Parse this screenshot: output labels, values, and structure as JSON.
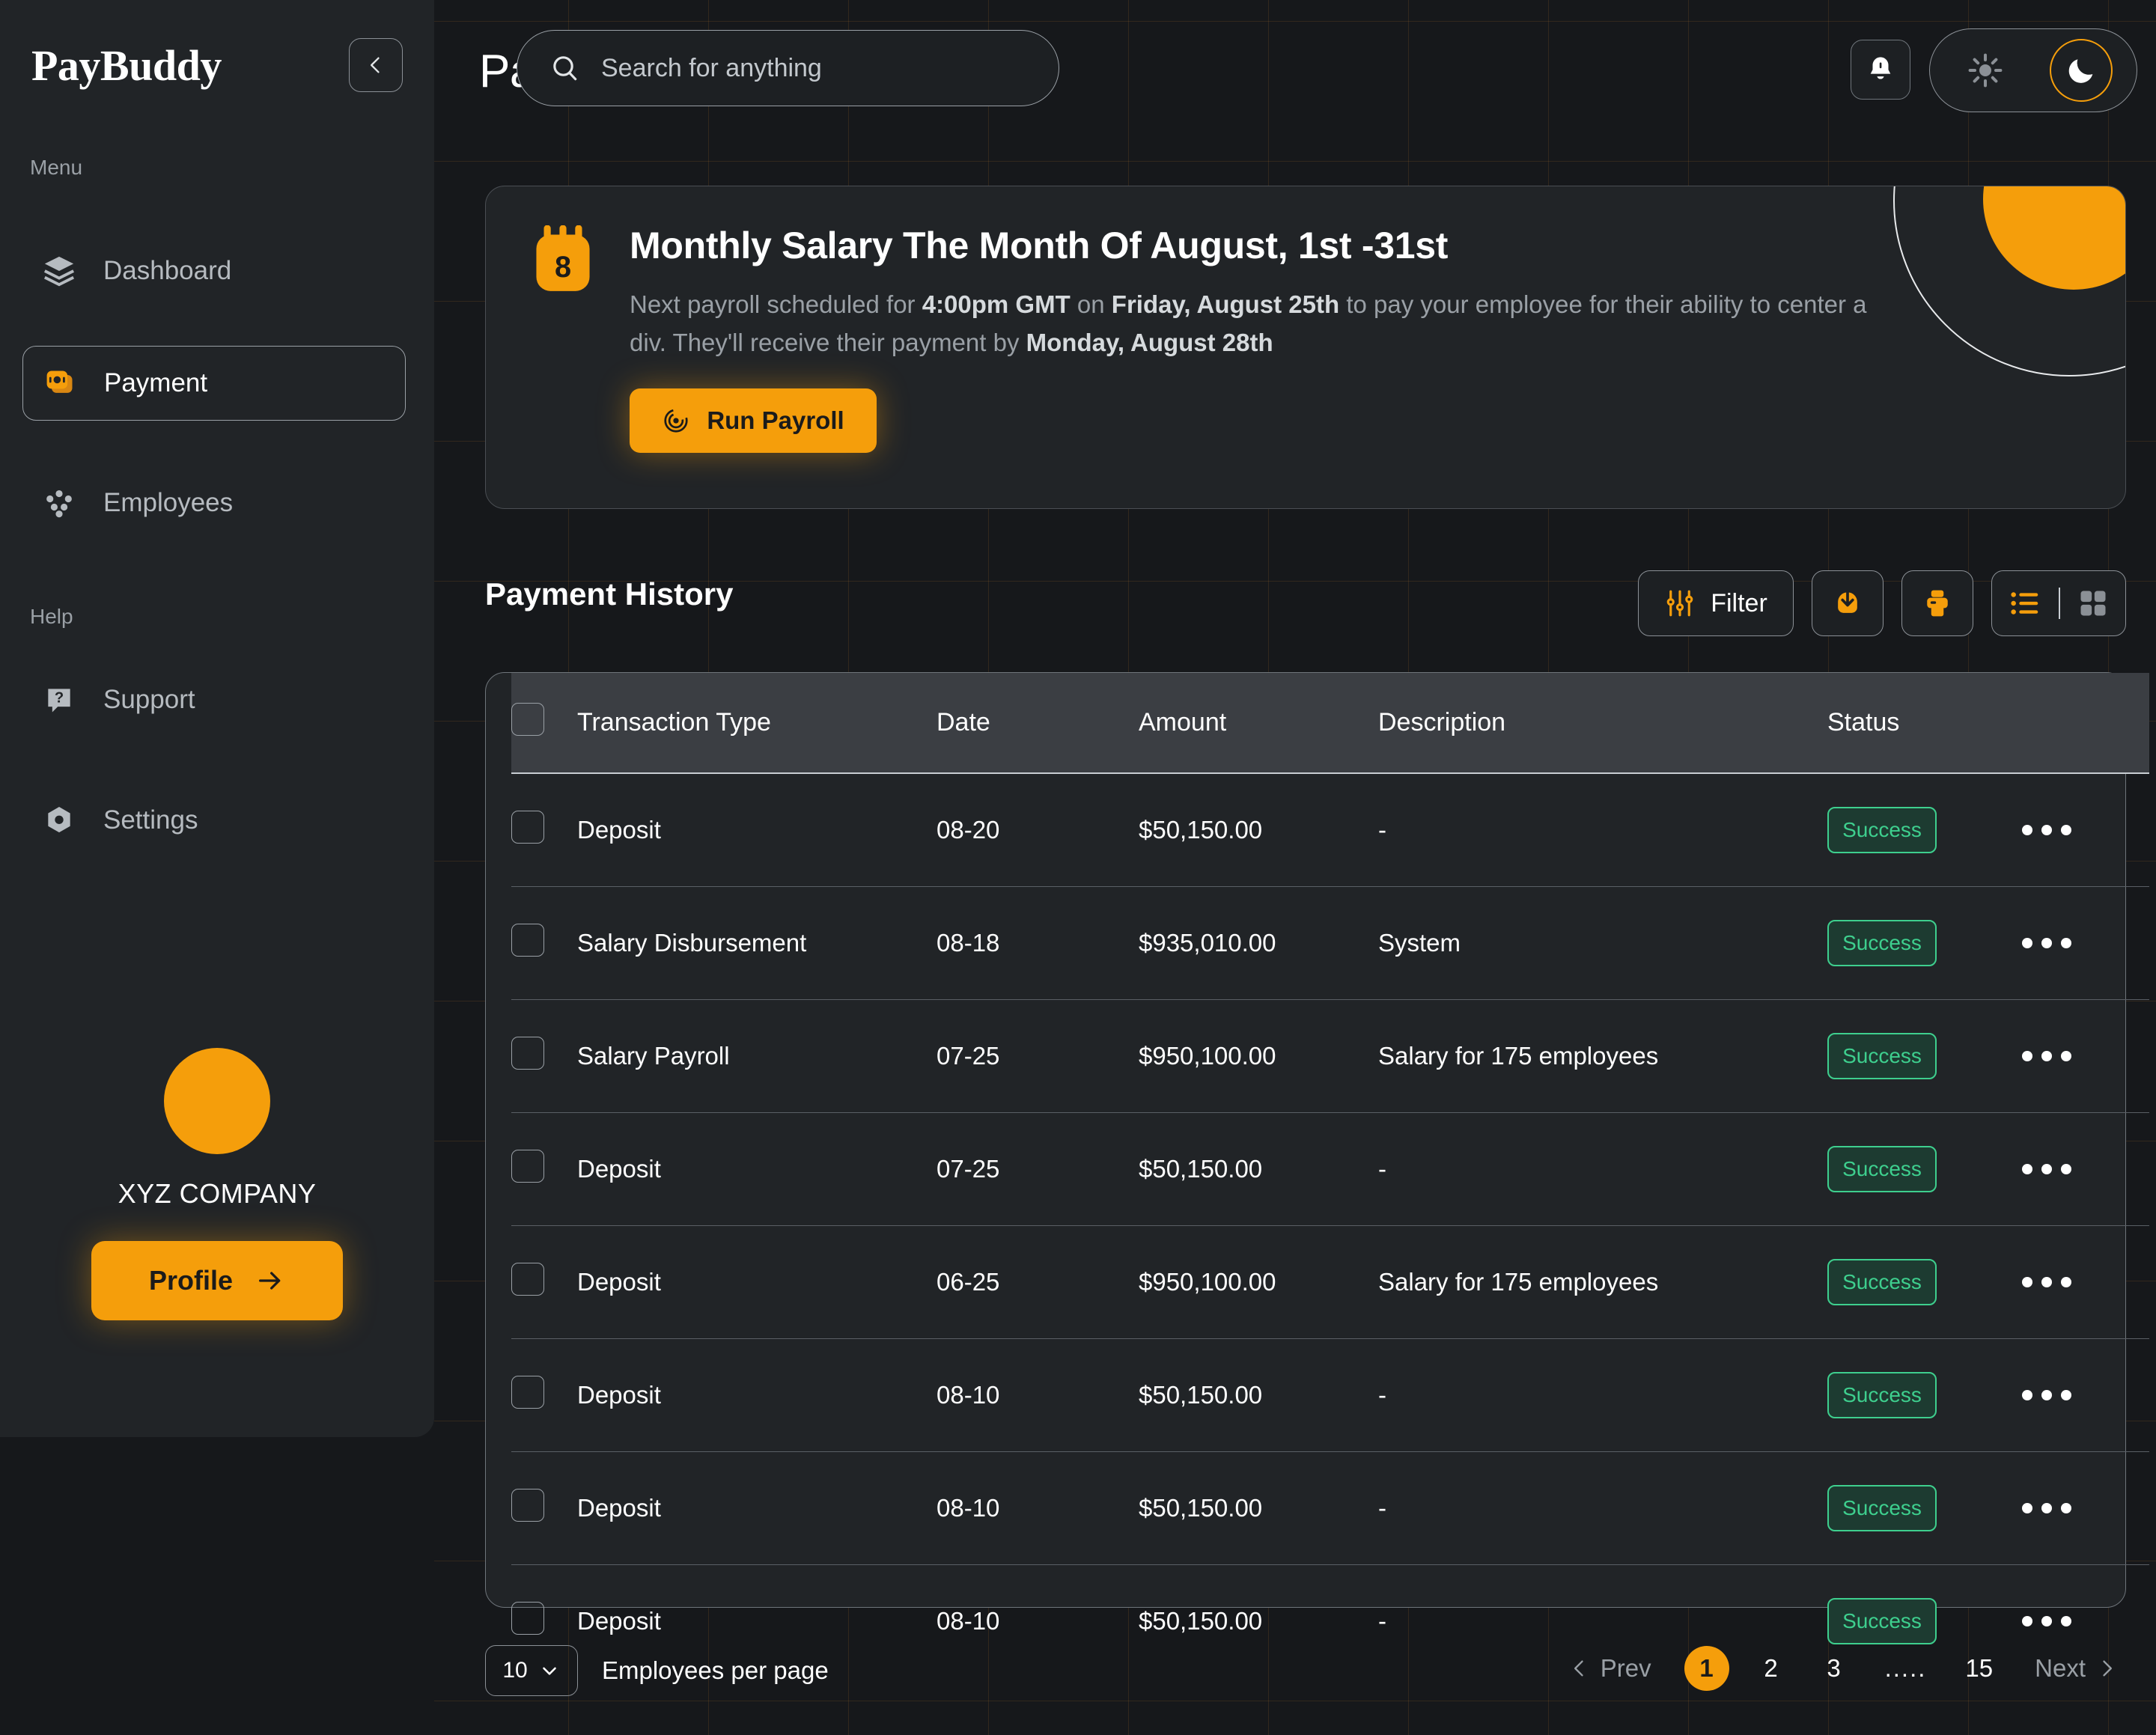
{
  "brand": {
    "name": "PayBuddy"
  },
  "sidebar": {
    "menu_label": "Menu",
    "help_label": "Help",
    "menu_items": [
      {
        "label": "Dashboard",
        "icon": "layers-icon"
      },
      {
        "label": "Payment",
        "icon": "payment-card-icon"
      },
      {
        "label": "Employees",
        "icon": "people-icon"
      }
    ],
    "help_items": [
      {
        "label": "Support",
        "icon": "question-chat-icon"
      },
      {
        "label": "Settings",
        "icon": "gear-icon"
      }
    ],
    "profile": {
      "company": "XYZ COMPANY",
      "button_label": "Profile"
    }
  },
  "header": {
    "title": "Payments",
    "search_placeholder": "Search for anything",
    "search_value": "",
    "bell_icon": "bell-icon",
    "theme": {
      "light_icon": "sun-icon",
      "dark_icon": "moon-icon",
      "active": "dark"
    }
  },
  "banner": {
    "calendar_day": "8",
    "title": "Monthly Salary The Month Of August, 1st -31st",
    "body_parts": [
      {
        "t": "Next payroll scheduled for ",
        "b": false
      },
      {
        "t": "4:00pm GMT",
        "b": true
      },
      {
        "t": " on ",
        "b": false
      },
      {
        "t": "Friday, August 25th",
        "b": true
      },
      {
        "t": " to pay your employee for their ability to center a div. They'll receive their payment by ",
        "b": false
      },
      {
        "t": "Monday, August 28th",
        "b": true
      }
    ],
    "run_button": "Run Payroll"
  },
  "section": {
    "title": "Payment History",
    "toolbar": {
      "filter_label": "Filter",
      "filter_icon": "sliders-icon",
      "download_icon": "download-icon",
      "print_icon": "print-icon",
      "list_view_icon": "list-view-icon",
      "grid_view_icon": "grid-view-icon",
      "active_view": "list"
    }
  },
  "table": {
    "columns": [
      "Transaction Type",
      "Date",
      "Amount",
      "Description",
      "Status"
    ],
    "rows": [
      {
        "type": "Deposit",
        "date": "08-20",
        "amount": "$50,150.00",
        "description": "-",
        "status": "Success"
      },
      {
        "type": "Salary Disbursement",
        "date": "08-18",
        "amount": "$935,010.00",
        "description": "System",
        "status": "Success"
      },
      {
        "type": "Salary Payroll",
        "date": "07-25",
        "amount": "$950,100.00",
        "description": "Salary for 175 employees",
        "status": "Success"
      },
      {
        "type": "Deposit",
        "date": "07-25",
        "amount": "$50,150.00",
        "description": "-",
        "status": "Success"
      },
      {
        "type": "Deposit",
        "date": "06-25",
        "amount": "$950,100.00",
        "description": "Salary for 175 employees",
        "status": "Success"
      },
      {
        "type": "Deposit",
        "date": "08-10",
        "amount": "$50,150.00",
        "description": "-",
        "status": "Success"
      },
      {
        "type": "Deposit",
        "date": "08-10",
        "amount": "$50,150.00",
        "description": "-",
        "status": "Success"
      },
      {
        "type": "Deposit",
        "date": "08-10",
        "amount": "$50,150.00",
        "description": "-",
        "status": "Success"
      }
    ]
  },
  "footer": {
    "per_page_value": "10",
    "per_page_label": "Employees per page",
    "prev_label": "Prev",
    "next_label": "Next",
    "pages": [
      "1",
      "2",
      "3",
      ".....",
      "15"
    ],
    "current_page": "1"
  },
  "colors": {
    "accent": "#f59e0b",
    "success": "#3ecf8e",
    "panel": "#212427",
    "background": "#16181b"
  }
}
